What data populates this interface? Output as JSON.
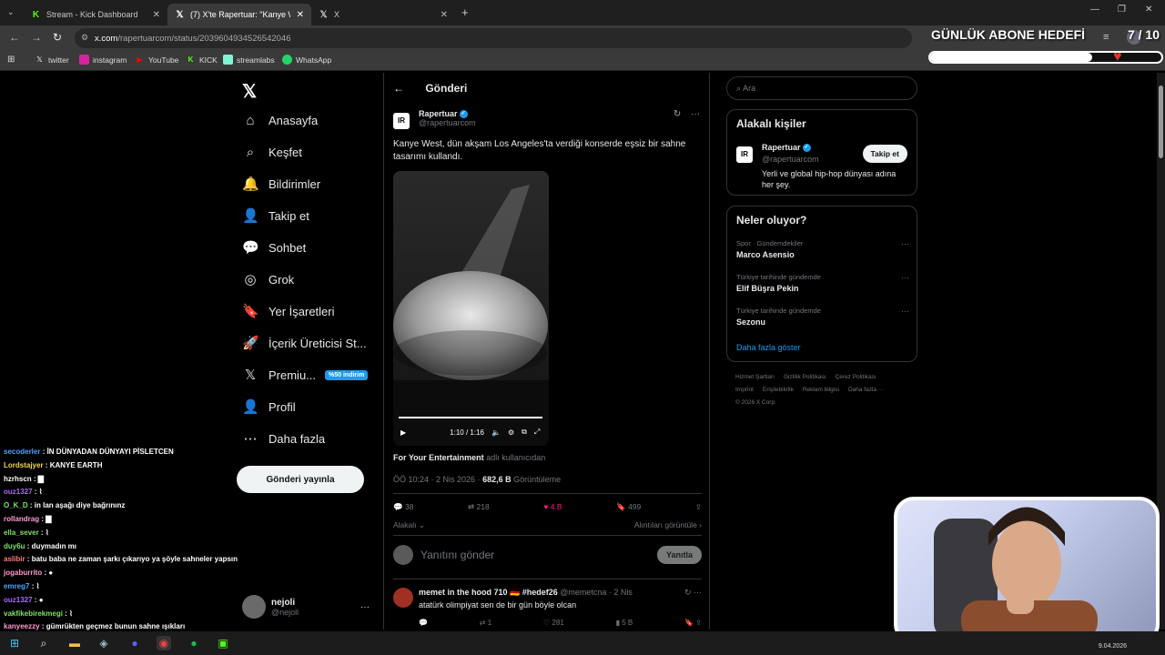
{
  "browser": {
    "tabs": [
      {
        "label": "Stream - Kick Dashboard",
        "icon": "kick-icon"
      },
      {
        "label": "(7) X'te Rapertuar: \"Kanye West",
        "icon": "x-icon"
      },
      {
        "label": "X",
        "icon": "x-icon"
      }
    ],
    "url_domain": "x.com",
    "url_path": "/rapertuarcom/status/2039604934526542046",
    "bookmarks": [
      "twitter",
      "instagram",
      "YouTube",
      "KICK",
      "streamlabs",
      "WhatsApp"
    ]
  },
  "overlay_goal": {
    "title": "GÜNLÜK ABONE HEDEFİ",
    "count": "7 / 10",
    "progress": 0.7
  },
  "x_nav": {
    "items": [
      {
        "label": "Anasayfa",
        "icon": "home-icon",
        "glyph": "⌂"
      },
      {
        "label": "Keşfet",
        "icon": "search-icon",
        "glyph": "⌕"
      },
      {
        "label": "Bildirimler",
        "icon": "bell-icon",
        "glyph": "🔔"
      },
      {
        "label": "Takip et",
        "icon": "person-add-icon",
        "glyph": "👤"
      },
      {
        "label": "Sohbet",
        "icon": "chat-icon",
        "glyph": "💬"
      },
      {
        "label": "Grok",
        "icon": "grok-icon",
        "glyph": "◎"
      },
      {
        "label": "Yer İşaretleri",
        "icon": "bookmark-icon",
        "glyph": "🔖"
      },
      {
        "label": "İçerik Üreticisi St...",
        "icon": "rocket-icon",
        "glyph": "🚀"
      },
      {
        "label": "Premiu...",
        "icon": "x-premium-icon",
        "glyph": "𝕏"
      },
      {
        "label": "Profil",
        "icon": "profile-icon",
        "glyph": "👤"
      },
      {
        "label": "Daha fazla",
        "icon": "more-circle-icon",
        "glyph": "⋯"
      }
    ],
    "premium_badge": "%50 indirim",
    "post_button": "Gönderi yayınla",
    "profile_name": "nejoli",
    "profile_handle": "@nejoli"
  },
  "post": {
    "header": "Gönderi",
    "author_name": "Rapertuar",
    "author_handle": "@rapertuarcom",
    "text": "Kanye West, dün akşam Los Angeles'ta verdiği konserde eşsiz bir sahne tasarımı kullandı.",
    "video_time": "1:10 / 1:16",
    "audio_attrib_name": "For Your Entertainment",
    "audio_attrib_user": "adlı kullanıcıdan",
    "time": "ÖÖ 10:24 · 2 Nis 2026 ·",
    "views": "682,6 B",
    "views_label": "Görüntüleme",
    "replies": "38",
    "reposts": "218",
    "likes": "4 B",
    "bookmarks": "499",
    "relevant": "Alakalı",
    "quotes": "Alıntıları görüntüle",
    "reply_placeholder": "Yanıtını gönder",
    "reply_button": "Yanıtla"
  },
  "comment": {
    "name": "memet in the hood 710 🇩🇪 #hedef26",
    "handle": "@memetcna · 2 Nis",
    "text": "atatürk olimpiyat sen de bir gün böyle olcan",
    "reposts": "1",
    "likes": "281",
    "views": "5 B"
  },
  "sidebar": {
    "search_placeholder": "Ara",
    "related_title": "Alakalı kişiler",
    "related_name": "Rapertuar",
    "related_handle": "@rapertuarcom",
    "related_bio": "Yerli ve global hip-hop dünyası adına her şey.",
    "follow_button": "Takip et",
    "trends_title": "Neler oluyor?",
    "trends": [
      {
        "context": "Spor · Gündemdekiler",
        "name": "Marco Asensio"
      },
      {
        "context": "Türkiye tarihinde gündemde",
        "name": "Elif Büşra Pekin"
      },
      {
        "context": "Türkiye tarihinde gündemde",
        "name": "Sezonu"
      }
    ],
    "show_more": "Daha fazla göster",
    "footer_line1": [
      "Hizmet Şartları",
      "Gizlilik Politikası",
      "Çerez Politikası"
    ],
    "footer_line2": [
      "Imprint",
      "Erişilebilirlik",
      "Reklam bilgisi",
      "Daha fazla ···"
    ],
    "copyright": "© 2026 X Corp."
  },
  "chat": [
    {
      "user": "secoderler",
      "text": "İN DÜNYADAN DÜNYAYI PİSLETCEN",
      "color": "#4ea3ff"
    },
    {
      "user": "Lordstajyer",
      "text": "KANYE EARTH",
      "color": "#f2d94e"
    },
    {
      "user": "hzrhscn",
      "text": "▇",
      "color": "#ffffff"
    },
    {
      "user": "ouz1327",
      "text": "⌇",
      "color": "#a66cff"
    },
    {
      "user": "O_K_D",
      "text": "in lan aşağı diye bağrınınz",
      "color": "#7ee06a"
    },
    {
      "user": "rollandrag",
      "text": "▇",
      "color": "#ff9bd2"
    },
    {
      "user": "ella_sever",
      "text": "⌇",
      "color": "#7ee06a"
    },
    {
      "user": "duy6u",
      "text": "duymadın mı",
      "color": "#7ee06a"
    },
    {
      "user": "aslibir",
      "text": "batu baba ne zaman şarkı çıkarıyo ya şöyle sahneler yapsın",
      "color": "#ff7f7f"
    },
    {
      "user": "jogaburrito",
      "text": "●",
      "color": "#ff9bd2"
    },
    {
      "user": "emreg7",
      "text": "⌇",
      "color": "#4ea3ff"
    },
    {
      "user": "ouz1327",
      "text": "●",
      "color": "#a66cff"
    },
    {
      "user": "vakfikebirekmegi",
      "text": "⌇",
      "color": "#7ee06a"
    },
    {
      "user": "kanyeezzy",
      "text": "gümrükten geçmez bunun sahne ışıkları",
      "color": "#ff9bd2"
    }
  ],
  "taskbar": {
    "date": "9.04.2026"
  }
}
